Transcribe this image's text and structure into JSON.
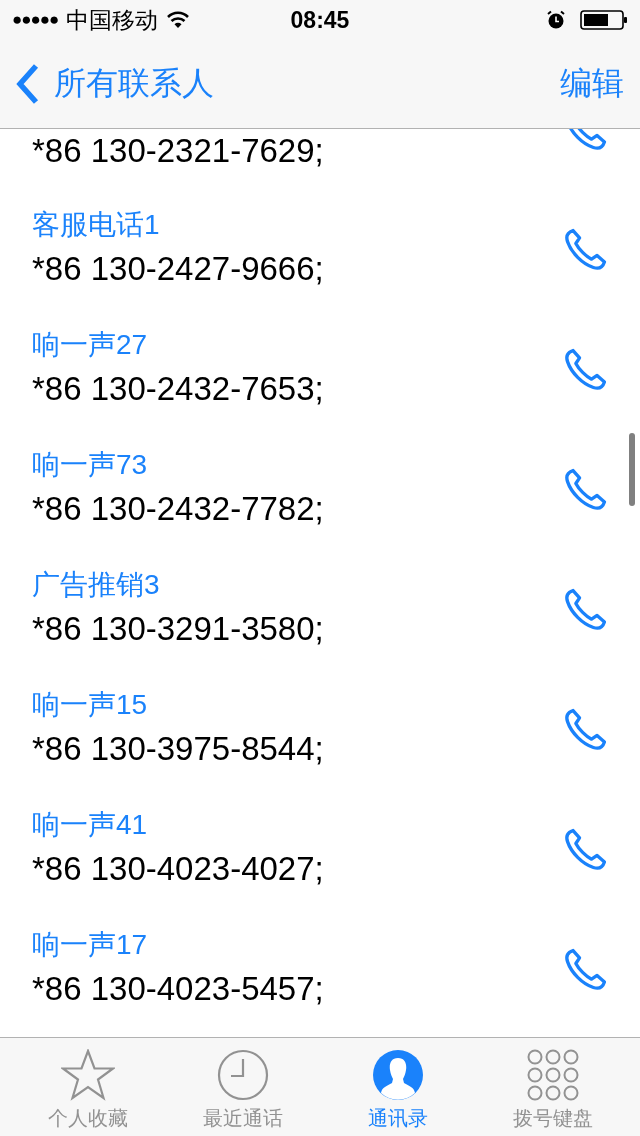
{
  "status_bar": {
    "signal_dots": "●●●●●",
    "carrier": "中国移动",
    "time": "08:45"
  },
  "nav_bar": {
    "back_label": "所有联系人",
    "action": "编辑"
  },
  "numbers": [
    {
      "number": "*86 130-2321-7629;"
    },
    {
      "name": "客服电话1",
      "number": "*86 130-2427-9666;"
    },
    {
      "name": "响一声27",
      "number": "*86 130-2432-7653;"
    },
    {
      "name": "响一声73",
      "number": "*86 130-2432-7782;"
    },
    {
      "name": "广告推销3",
      "number": "*86 130-3291-3580;"
    },
    {
      "name": "响一声15",
      "number": "*86 130-3975-8544;"
    },
    {
      "name": "响一声41",
      "number": "*86 130-4023-4027;"
    },
    {
      "name": "响一声17",
      "number": "*86 130-4023-5457;"
    }
  ],
  "tab_bar": [
    {
      "kind": "favorites",
      "label": "个人收藏",
      "selected": false
    },
    {
      "kind": "recents",
      "label": "最近通话",
      "selected": false
    },
    {
      "kind": "contacts",
      "label": "通讯录",
      "selected": true
    },
    {
      "kind": "keypad",
      "label": "拨号键盘",
      "selected": false
    }
  ]
}
